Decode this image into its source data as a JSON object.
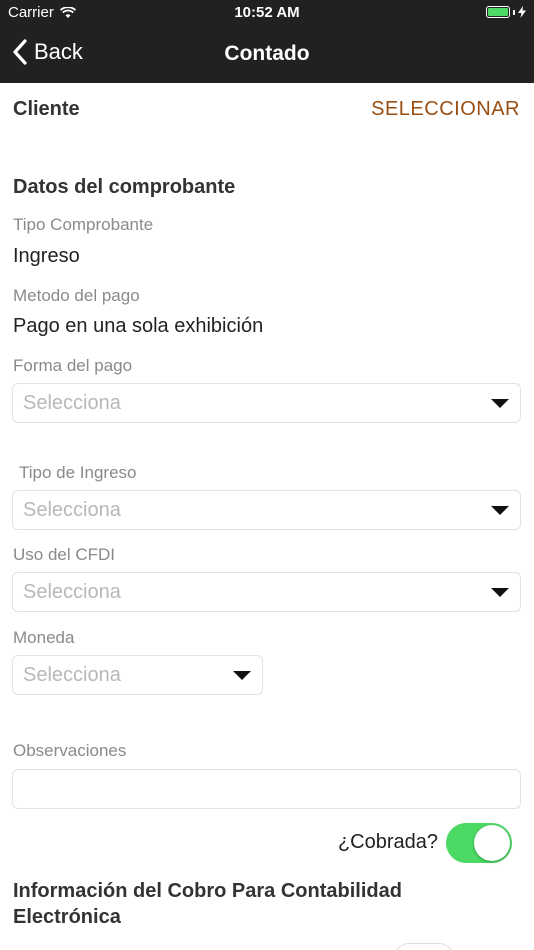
{
  "status_bar": {
    "carrier": "Carrier",
    "time": "10:52 AM"
  },
  "nav": {
    "back_label": "Back",
    "title": "Contado"
  },
  "cliente": {
    "label": "Cliente",
    "action": "SELECCIONAR"
  },
  "comprobante": {
    "section_title": "Datos del comprobante",
    "tipo_label": "Tipo Comprobante",
    "tipo_value": "Ingreso",
    "metodo_label": "Metodo del pago",
    "metodo_value": "Pago en una sola exhibición",
    "forma_label": "Forma del pago",
    "forma_placeholder": "Selecciona",
    "tipo_ingreso_label": "Tipo de Ingreso",
    "tipo_ingreso_placeholder": "Selecciona",
    "uso_label": "Uso del CFDI",
    "uso_placeholder": "Selecciona",
    "moneda_label": "Moneda",
    "moneda_placeholder": "Selecciona",
    "observaciones_label": "Observaciones",
    "observaciones_value": ""
  },
  "cobrada": {
    "label": "¿Cobrada?",
    "on": true
  },
  "cobro_info": {
    "title": "Información del Cobro Para Contabilidad Electrónica"
  },
  "colors": {
    "accent": "#9a4f12",
    "toggle_on": "#4cd964",
    "nav_bg": "#212121"
  }
}
